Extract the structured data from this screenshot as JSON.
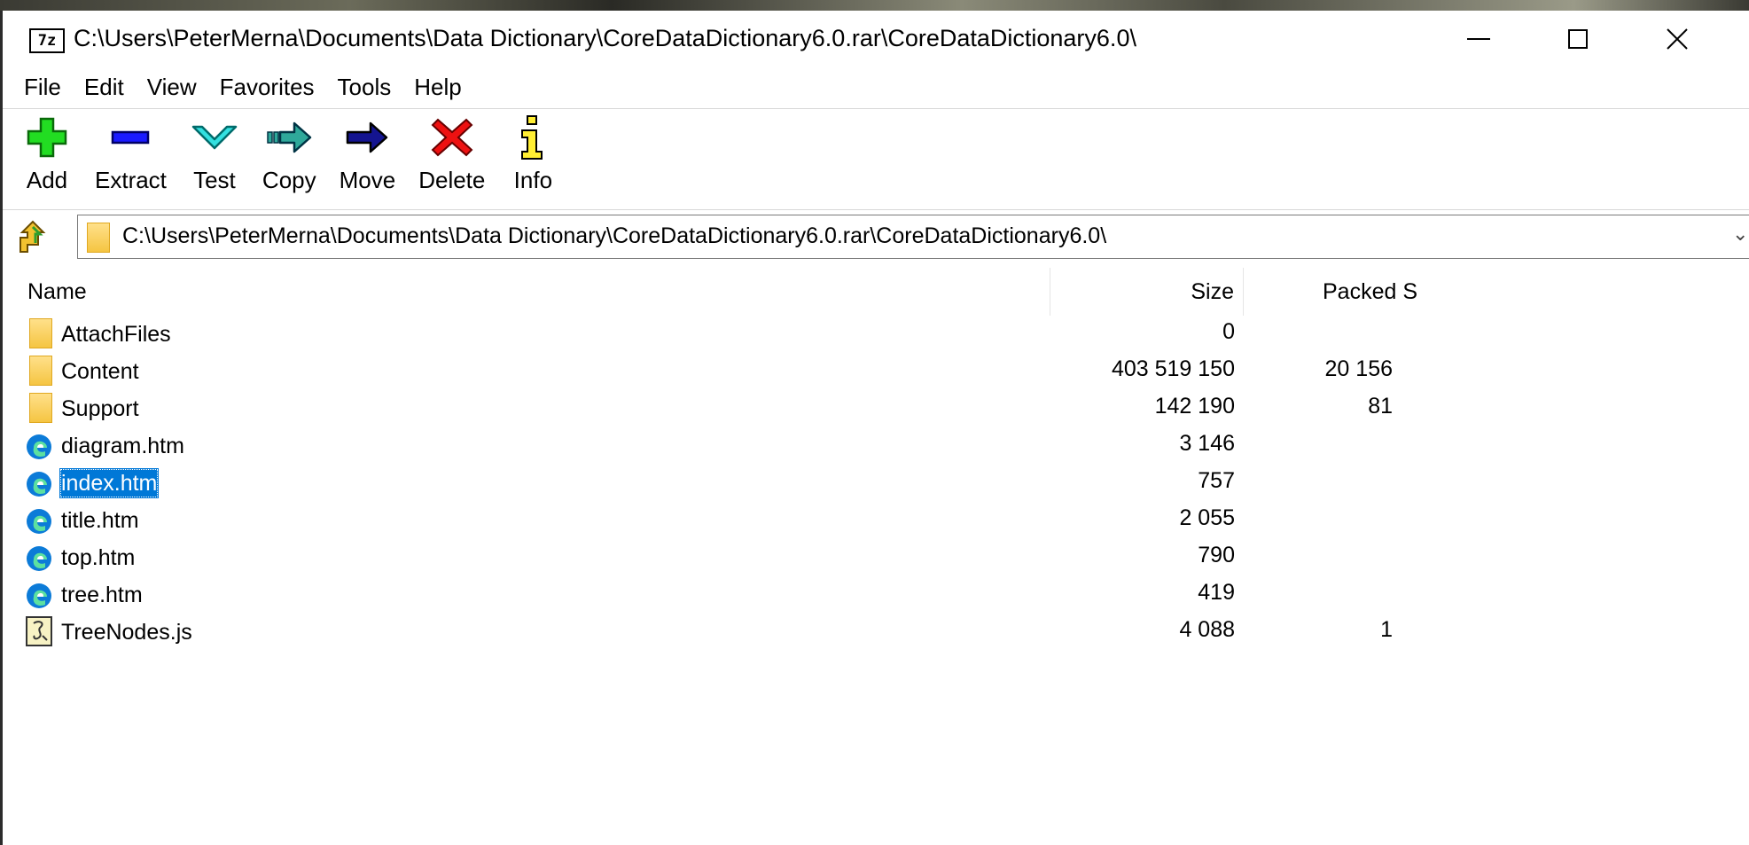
{
  "window": {
    "title": "C:\\Users\\PeterMerna\\Documents\\Data Dictionary\\CoreDataDictionary6.0.rar\\CoreDataDictionary6.0\\",
    "app_icon_text": "7z",
    "minimize": "—",
    "maximize": "☐",
    "close": "✕"
  },
  "menu": [
    "File",
    "Edit",
    "View",
    "Favorites",
    "Tools",
    "Help"
  ],
  "toolbar": [
    {
      "label": "Add",
      "icon": "add-icon"
    },
    {
      "label": "Extract",
      "icon": "extract-icon"
    },
    {
      "label": "Test",
      "icon": "test-icon"
    },
    {
      "label": "Copy",
      "icon": "copy-icon"
    },
    {
      "label": "Move",
      "icon": "move-icon"
    },
    {
      "label": "Delete",
      "icon": "delete-icon"
    },
    {
      "label": "Info",
      "icon": "info-icon"
    }
  ],
  "address": {
    "path": "C:\\Users\\PeterMerna\\Documents\\Data Dictionary\\CoreDataDictionary6.0.rar\\CoreDataDictionary6.0\\",
    "chevron": "⌄"
  },
  "columns": {
    "name": "Name",
    "size": "Size",
    "packed": "Packed S"
  },
  "files": [
    {
      "name": "AttachFiles",
      "type": "folder",
      "size": "0",
      "packed": "",
      "selected": false
    },
    {
      "name": "Content",
      "type": "folder",
      "size": "403 519 150",
      "packed": "20 156",
      "selected": false
    },
    {
      "name": "Support",
      "type": "folder",
      "size": "142 190",
      "packed": "81",
      "selected": false
    },
    {
      "name": "diagram.htm",
      "type": "htm",
      "size": "3 146",
      "packed": "",
      "selected": false
    },
    {
      "name": "index.htm",
      "type": "htm",
      "size": "757",
      "packed": "",
      "selected": true
    },
    {
      "name": "title.htm",
      "type": "htm",
      "size": "2 055",
      "packed": "",
      "selected": false
    },
    {
      "name": "top.htm",
      "type": "htm",
      "size": "790",
      "packed": "",
      "selected": false
    },
    {
      "name": "tree.htm",
      "type": "htm",
      "size": "419",
      "packed": "",
      "selected": false
    },
    {
      "name": "TreeNodes.js",
      "type": "js",
      "size": "4 088",
      "packed": "1",
      "selected": false
    }
  ],
  "colors": {
    "selection": "#0078d7",
    "folder": "#f5c542"
  }
}
